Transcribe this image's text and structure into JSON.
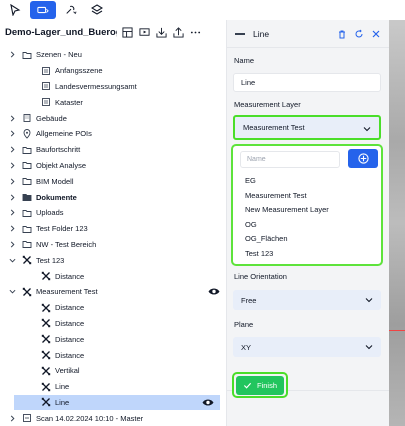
{
  "toolbar": {
    "items": [
      "cursor-icon",
      "measure-icon",
      "tools-icon",
      "layers-icon"
    ]
  },
  "project": {
    "title": "Demo-Lager_und_Bueroge..."
  },
  "tree": [
    {
      "label": "Szenen - Neu",
      "depth": 0,
      "chevron": "right",
      "icon": "folder",
      "bold": false
    },
    {
      "label": "Anfangsszene",
      "depth": 1,
      "chevron": "",
      "icon": "doc",
      "bold": false
    },
    {
      "label": "Landesvermessungsamt",
      "depth": 1,
      "chevron": "",
      "icon": "doc",
      "bold": false
    },
    {
      "label": "Kataster",
      "depth": 1,
      "chevron": "",
      "icon": "doc",
      "bold": false
    },
    {
      "label": "Gebäude",
      "depth": 0,
      "chevron": "right",
      "icon": "building",
      "bold": false
    },
    {
      "label": "Allgemeine POIs",
      "depth": 0,
      "chevron": "right",
      "icon": "pin",
      "bold": false
    },
    {
      "label": "Baufortschritt",
      "depth": 0,
      "chevron": "right",
      "icon": "folder",
      "bold": false
    },
    {
      "label": "Objekt Analyse",
      "depth": 0,
      "chevron": "right",
      "icon": "folder",
      "bold": false
    },
    {
      "label": "BIM Modell",
      "depth": 0,
      "chevron": "right",
      "icon": "folder",
      "bold": false
    },
    {
      "label": "Dokumente",
      "depth": 0,
      "chevron": "right",
      "icon": "folder-open",
      "bold": true
    },
    {
      "label": "Uploads",
      "depth": 0,
      "chevron": "right",
      "icon": "folder",
      "bold": false
    },
    {
      "label": "Test Folder 123",
      "depth": 0,
      "chevron": "right",
      "icon": "folder",
      "bold": false
    },
    {
      "label": "NW - Test Bereich",
      "depth": 0,
      "chevron": "right",
      "icon": "folder",
      "bold": false
    },
    {
      "label": "Test 123",
      "depth": 0,
      "chevron": "down",
      "icon": "measure",
      "bold": false
    },
    {
      "label": "Distance",
      "depth": 1,
      "chevron": "",
      "icon": "measure",
      "bold": false
    },
    {
      "label": "Measurement Test",
      "depth": 0,
      "chevron": "down",
      "icon": "measure",
      "bold": false,
      "eye": true
    },
    {
      "label": "Distance",
      "depth": 1,
      "chevron": "",
      "icon": "measure",
      "bold": false
    },
    {
      "label": "Distance",
      "depth": 1,
      "chevron": "",
      "icon": "measure",
      "bold": false
    },
    {
      "label": "Distance",
      "depth": 1,
      "chevron": "",
      "icon": "measure",
      "bold": false
    },
    {
      "label": "Distance",
      "depth": 1,
      "chevron": "",
      "icon": "measure",
      "bold": false
    },
    {
      "label": "Vertikal",
      "depth": 1,
      "chevron": "",
      "icon": "measure",
      "bold": false
    },
    {
      "label": "Line",
      "depth": 1,
      "chevron": "",
      "icon": "measure",
      "bold": false
    },
    {
      "label": "Line",
      "depth": 1,
      "chevron": "",
      "icon": "measure",
      "bold": false,
      "selected": true,
      "eye": true
    },
    {
      "label": "Scan 14.02.2024 10:10 - Master",
      "depth": 0,
      "chevron": "right",
      "icon": "scan",
      "bold": false
    }
  ],
  "panel": {
    "title": "Line",
    "name_label": "Name",
    "name_value": "Line",
    "layer_label": "Measurement Layer",
    "layer_value": "Measurement Test",
    "search_placeholder": "Name",
    "options": [
      "EG",
      "Measurement Test",
      "New Measurement Layer",
      "OG",
      "OG_Flächen",
      "Test 123"
    ],
    "orientation_label": "Line Orientation",
    "orientation_value": "Free",
    "plane_label": "Plane",
    "plane_value": "XY",
    "finish_label": "Finish"
  },
  "colors": {
    "accent": "#2563eb",
    "highlight": "#4ade2a",
    "finish": "#22c55e",
    "selected_row": "#bfd6fb"
  }
}
